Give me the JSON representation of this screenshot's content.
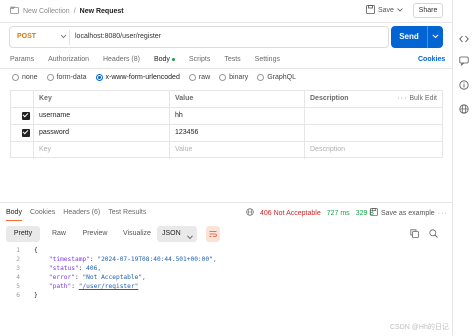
{
  "header": {
    "collection": "New Collection",
    "separator": "/",
    "request_name": "New Request",
    "save_label": "Save",
    "share_label": "Share"
  },
  "request": {
    "method": "POST",
    "url": "localhost:8080/user/register",
    "send_label": "Send"
  },
  "request_tabs": [
    "Params",
    "Authorization",
    "Headers (8)",
    "Body",
    "Scripts",
    "Tests",
    "Settings"
  ],
  "request_active_tab": "Body",
  "cookies_label": "Cookies",
  "body_types": [
    "none",
    "form-data",
    "x-www-form-urlencoded",
    "raw",
    "binary",
    "GraphQL"
  ],
  "body_type_selected": "x-www-form-urlencoded",
  "kv_table": {
    "headers": {
      "key": "Key",
      "value": "Value",
      "description": "Description",
      "bulk_edit": "Bulk Edit"
    },
    "rows": [
      {
        "key": "username",
        "value": "hh",
        "description": "",
        "checked": true
      },
      {
        "key": "password",
        "value": "123456",
        "description": "",
        "checked": true
      }
    ],
    "placeholder": {
      "key": "Key",
      "value": "Value",
      "description": "Description"
    }
  },
  "response": {
    "tabs": [
      "Body",
      "Cookies",
      "Headers (6)",
      "Test Results"
    ],
    "active_tab": "Body",
    "status": "406 Not Acceptable",
    "time": "727 ms",
    "size": "329 B",
    "save_example_label": "Save as example",
    "formats": [
      "Pretty",
      "Raw",
      "Preview",
      "Visualize"
    ],
    "active_format": "Pretty",
    "language": "JSON",
    "lines": [
      {
        "n": "1",
        "text": "{"
      },
      {
        "n": "2",
        "key": "\"timestamp\"",
        "value": "\"2024-07-19T08:40:44.501+00:00\","
      },
      {
        "n": "3",
        "key": "\"status\"",
        "value": "406,"
      },
      {
        "n": "4",
        "key": "\"error\"",
        "value": "\"Not Acceptable\","
      },
      {
        "n": "5",
        "key": "\"path\"",
        "value": "\"/user/register\"",
        "is_link": true
      },
      {
        "n": "6",
        "text": "}"
      }
    ]
  },
  "colors": {
    "send": "#0265d2",
    "method": "#d97904",
    "status_error": "#c62828",
    "status_ok": "#16a34a",
    "accent_tab": "#ff6c37"
  },
  "icons": [
    "save-icon",
    "chevron-down-icon",
    "code-icon",
    "info-icon",
    "globe-icon",
    "copy-icon",
    "search-icon",
    "wrap-icon",
    "filter-icon"
  ],
  "watermark": "CSDN @Hh的日记"
}
